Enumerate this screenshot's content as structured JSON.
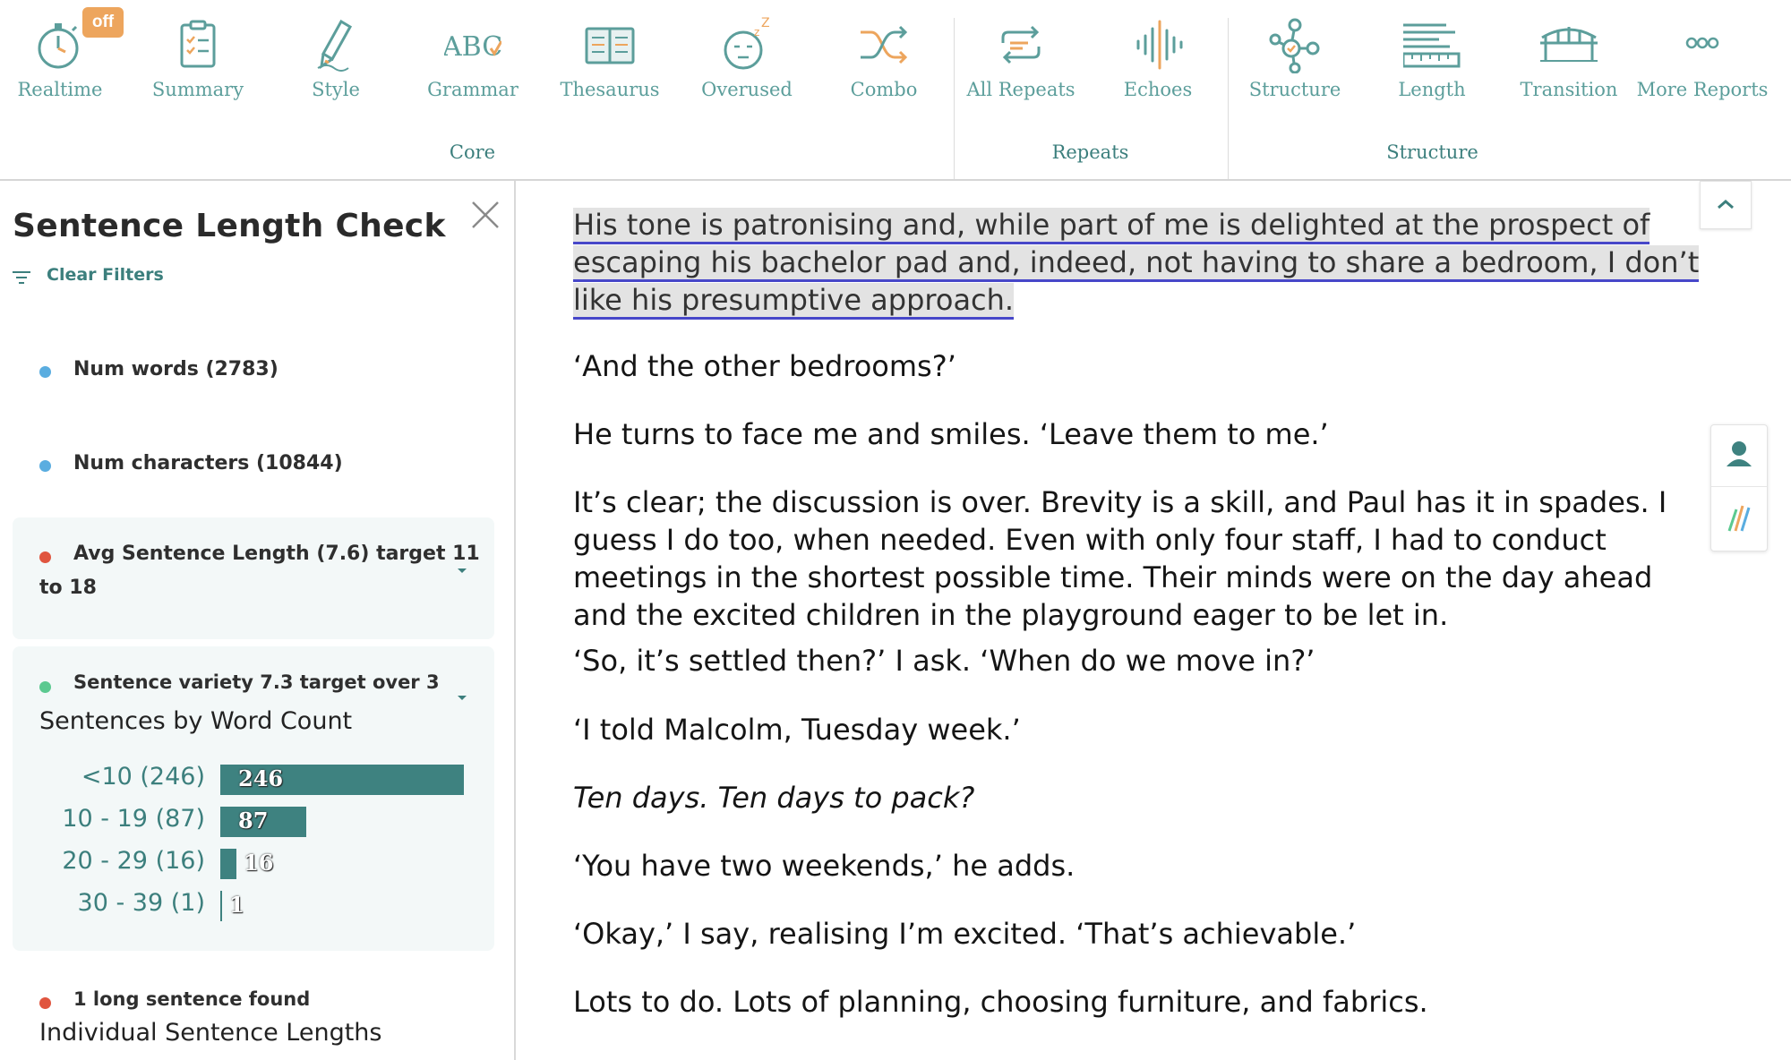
{
  "toolbar": {
    "realtime_badge": "off",
    "items": [
      {
        "label": "Realtime",
        "icon": "stopwatch-icon"
      },
      {
        "label": "Summary",
        "icon": "clipboard-icon"
      },
      {
        "label": "Style",
        "icon": "pencil-icon"
      },
      {
        "label": "Grammar",
        "icon": "abc-check-icon"
      },
      {
        "label": "Thesaurus",
        "icon": "book-icon"
      },
      {
        "label": "Overused",
        "icon": "sleepy-face-icon"
      },
      {
        "label": "Combo",
        "icon": "shuffle-icon"
      },
      {
        "label": "All Repeats",
        "icon": "repeat-arrows-icon"
      },
      {
        "label": "Echoes",
        "icon": "soundwave-icon"
      },
      {
        "label": "Structure",
        "icon": "nodes-icon"
      },
      {
        "label": "Length",
        "icon": "ruler-lines-icon"
      },
      {
        "label": "Transition",
        "icon": "bridge-icon"
      },
      {
        "label": "More Reports",
        "icon": "more-dots-icon"
      }
    ],
    "groups": [
      "Core",
      "Repeats",
      "Structure"
    ],
    "colors": {
      "teal": "#5c9e9b",
      "dark_teal": "#3c7f7d",
      "orange": "#eda55d"
    }
  },
  "panel": {
    "title": "Sentence Length Check",
    "clear_filters": "Clear Filters",
    "num_words": "Num words (2783)",
    "num_characters": "Num characters (10844)",
    "avg_sentence_length_line1": "Avg Sentence Length (7.6) target 11",
    "avg_sentence_length_line2": "to 18",
    "sentence_variety": "Sentence variety 7.3 target over 3",
    "sentences_by_word_count": "Sentences by Word Count",
    "long_sentences": "1 long sentence found",
    "individual_lengths": "Individual Sentence Lengths",
    "status_colors": {
      "info": "#5aade0",
      "warn": "#e0553f",
      "ok": "#5bc990"
    }
  },
  "chart_data": {
    "type": "bar",
    "orientation": "horizontal",
    "title": "Sentences by Word Count",
    "categories": [
      "<10 (246)",
      "10 - 19 (87)",
      "20 - 29 (16)",
      "30 - 39 (1)"
    ],
    "values": [
      246,
      87,
      16,
      1
    ],
    "value_labels": [
      "246",
      "87",
      "16",
      "1"
    ],
    "color": "#3e8280"
  },
  "editor": {
    "highlighted_sentence": "His tone is patronising and, while part of me is delighted at the prospect of escaping his bachelor pad and, indeed, not having to share a bedroom, I don’t like his presumptive approach. ",
    "paragraphs": [
      "‘And the other bedrooms?’",
      "He turns to face me and smiles. ‘Leave them to me.’",
      "It’s clear; the discussion is over. Brevity is a skill, and Paul has it in spades. I guess I do too, when needed. Even with only four staff, I had to conduct meetings in the shortest possible time. Their minds were on the day ahead and the excited children in the playground eager to be let in.",
      "‘So, it’s settled then?’ I ask. ‘When do we move in?’",
      "‘I told Malcolm, Tuesday week.’",
      "Ten days. Ten days to pack?",
      "‘You have two weekends,’ he adds.",
      "‘Okay,’ I say, realising I’m excited. ‘That’s achievable.’",
      "Lots to do. Lots of planning, choosing furniture, and fabrics."
    ]
  }
}
